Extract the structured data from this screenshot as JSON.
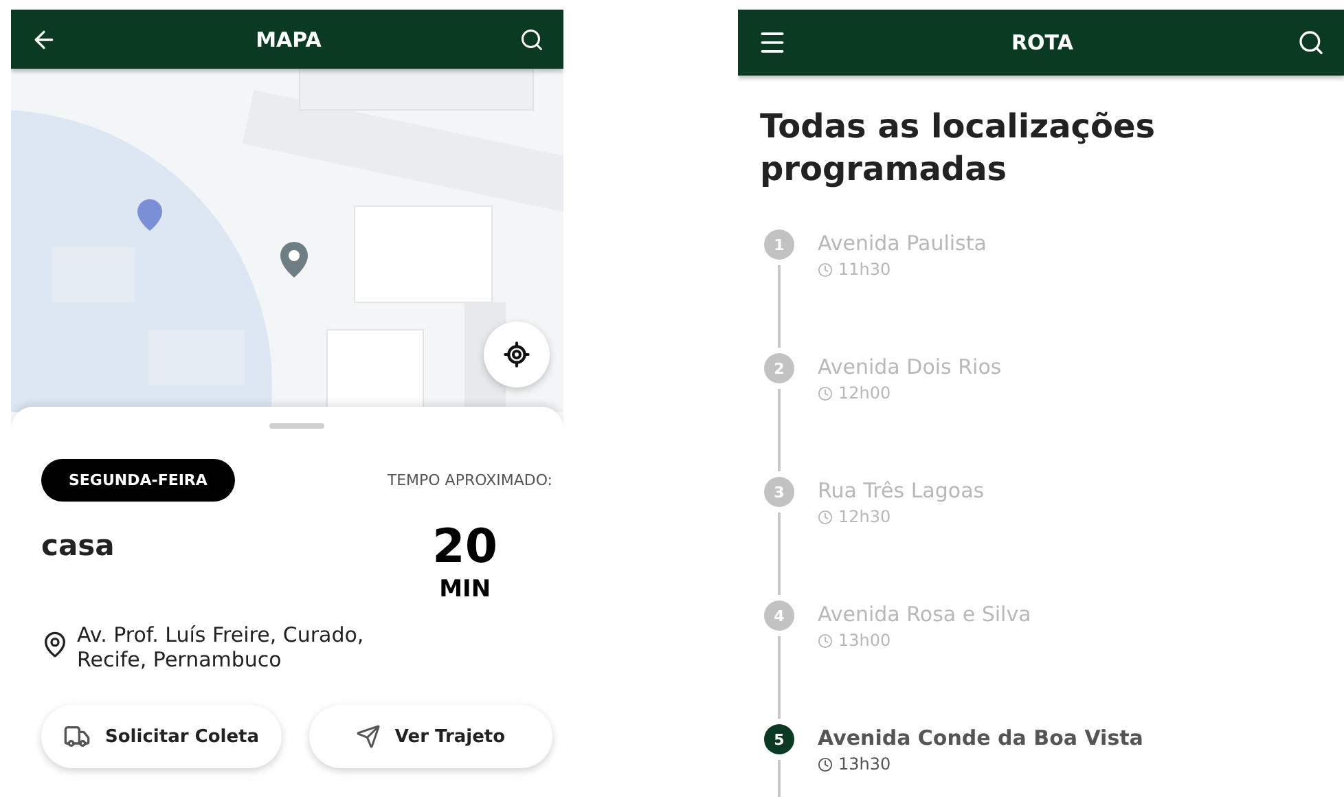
{
  "map_screen": {
    "header": {
      "title": "MAPA"
    },
    "sheet": {
      "day_chip": "SEGUNDA-FEIRA",
      "time_label": "TEMPO APROXIMADO:",
      "place": "casa",
      "time_value": "20",
      "time_unit": "MIN",
      "address": "Av. Prof. Luís Freire, Curado, Recife, Pernambuco",
      "buttons": [
        {
          "label": "Solicitar Coleta",
          "kind": "truck"
        },
        {
          "label": "Ver Trajeto",
          "kind": "send"
        }
      ]
    }
  },
  "route_screen": {
    "header": {
      "title": "ROTA"
    },
    "heading": "Todas as localizações programadas",
    "stops": [
      {
        "number": "1",
        "name": "Avenida Paulista",
        "time": "11h30",
        "selected": false
      },
      {
        "number": "2",
        "name": "Avenida Dois Rios",
        "time": "12h00",
        "selected": false
      },
      {
        "number": "3",
        "name": "Rua Três Lagoas",
        "time": "12h30",
        "selected": false
      },
      {
        "number": "4",
        "name": "Avenida Rosa e Silva",
        "time": "13h00",
        "selected": false
      },
      {
        "number": "5",
        "name": "Avenida Conde da Boa Vista",
        "time": "13h30",
        "selected": true
      }
    ]
  }
}
